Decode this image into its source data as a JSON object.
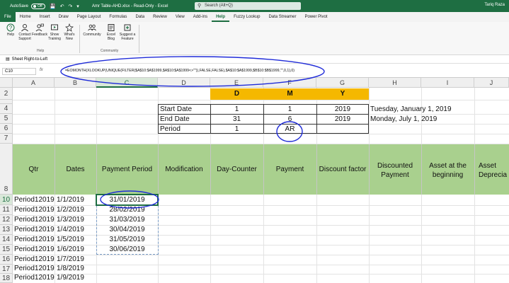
{
  "titlebar": {
    "autosave": "AutoSave",
    "autosave_state": "Off",
    "title": "Amr Table-AHD.xlsx  -  Read-Only  -  Excel",
    "search_placeholder": "Search (Alt+Q)",
    "user": "Tariq Raza"
  },
  "tabs": [
    "File",
    "Home",
    "Insert",
    "Draw",
    "Page Layout",
    "Formulas",
    "Data",
    "Review",
    "View",
    "Add-ins",
    "Help",
    "Fuzzy Lookup",
    "Data Streamer",
    "Power Pivot"
  ],
  "active_tab": "Help",
  "ribbon": {
    "help_group": {
      "label": "Help",
      "buttons": [
        "Help",
        "Contact Support",
        "Feedback",
        "Show Training",
        "What's New"
      ]
    },
    "community_group": {
      "label": "Community",
      "buttons": [
        "Community",
        "Excel Blog",
        "Suggest a Feature"
      ]
    }
  },
  "subbar": {
    "label": "Sheet Right-to-Left"
  },
  "formula_bar": {
    "name_box": "C10",
    "fx": "fx",
    "formula": "=EOMONTH(XLOOKUP(UNIQUE(FILTER($A$10:$A$1999,$A$10:$A$1999<>\"\")),FALSE,FALSE),$A$10:$A$1999,$B$10:$B$1999,\"\",0,1),0)"
  },
  "columns": [
    "A",
    "B",
    "C",
    "D",
    "E",
    "F",
    "G",
    "H",
    "I",
    "J"
  ],
  "rows": [
    "2",
    "4",
    "5",
    "6",
    "7",
    "8",
    "10",
    "11",
    "12",
    "13",
    "14",
    "15",
    "16",
    "17",
    "18"
  ],
  "params": {
    "hdr_d": "D",
    "hdr_m": "M",
    "hdr_y": "Y",
    "start_label": "Start Date",
    "start_d": "1",
    "start_m": "1",
    "start_y": "2019",
    "start_text": "Tuesday, January 1, 2019",
    "end_label": "End Date",
    "end_d": "31",
    "end_m": "6",
    "end_y": "2019",
    "end_text": "Monday, July 1, 2019",
    "period_label": "Period",
    "period_d": "1",
    "period_m": "AR"
  },
  "table_headers": [
    "Qtr",
    "Dates",
    "Payment Period",
    "Modification",
    "Day-Counter",
    "Payment",
    "Discount factor",
    "Discounted Payment",
    "Asset at the beginning",
    "Asset Depreciation"
  ],
  "data_rows": [
    {
      "qtr": "Period12019",
      "date": "1/1/2019",
      "payment": "31/01/2019"
    },
    {
      "qtr": "Period12019",
      "date": "1/2/2019",
      "payment": "28/02/2019"
    },
    {
      "qtr": "Period12019",
      "date": "1/3/2019",
      "payment": "31/03/2019"
    },
    {
      "qtr": "Period12019",
      "date": "1/4/2019",
      "payment": "30/04/2019"
    },
    {
      "qtr": "Period12019",
      "date": "1/5/2019",
      "payment": "31/05/2019"
    },
    {
      "qtr": "Period12019",
      "date": "1/6/2019",
      "payment": "30/06/2019"
    },
    {
      "qtr": "Period12019",
      "date": "1/7/2019",
      "payment": ""
    },
    {
      "qtr": "Period12019",
      "date": "1/8/2019",
      "payment": ""
    },
    {
      "qtr": "Period12019",
      "date": "1/9/2019",
      "payment": ""
    }
  ],
  "colors": {
    "excel_green": "#1e6e42",
    "header_green": "#a9d08e",
    "orange": "#f5b800",
    "annotation": "#1f2bd8"
  }
}
